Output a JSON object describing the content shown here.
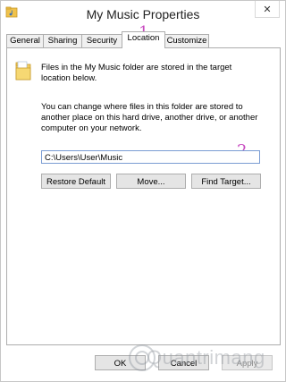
{
  "window": {
    "title": "My Music Properties",
    "close_symbol": "✕",
    "icon": "music-folder-icon"
  },
  "tabs": [
    {
      "label": "General",
      "active": false
    },
    {
      "label": "Sharing",
      "active": false
    },
    {
      "label": "Security",
      "active": false
    },
    {
      "label": "Location",
      "active": true
    },
    {
      "label": "Customize",
      "active": false
    }
  ],
  "location": {
    "intro_line1": "Files in the My Music folder are stored in the target",
    "intro_line2": "location below.",
    "desc_line1": "You can change where files in this folder are stored to",
    "desc_line2": "another place on this hard drive, another drive, or another",
    "desc_line3": "computer on your network.",
    "path_value": "C:\\Users\\User\\Music",
    "restore_default_label": "Restore Default",
    "move_label": "Move...",
    "find_target_label": "Find Target..."
  },
  "annotations": {
    "marker_1": "1",
    "marker_2": "2",
    "color": "#c84ac0"
  },
  "footer": {
    "ok_label": "OK",
    "cancel_label": "Cancel",
    "apply_label": "Apply"
  },
  "watermark": {
    "text": "Quantrimang"
  }
}
